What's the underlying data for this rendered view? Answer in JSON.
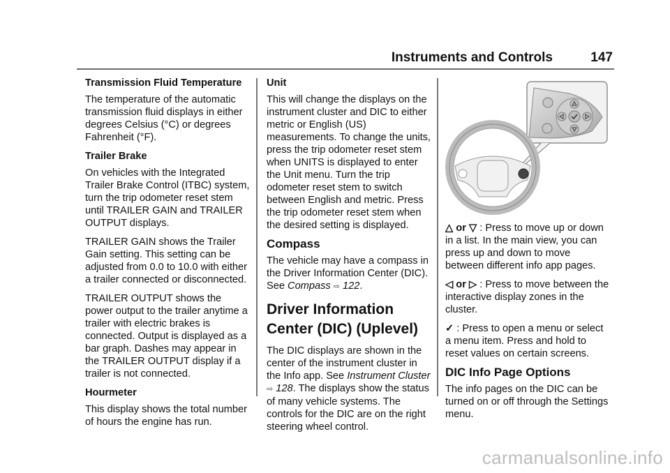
{
  "header": {
    "section": "Instruments and Controls",
    "page_number": "147"
  },
  "col1": {
    "h_transmission": "Transmission Fluid Temperature",
    "p_transmission": "The temperature of the automatic transmission fluid displays in either degrees Celsius (°C) or degrees Fahrenheit (°F).",
    "h_trailer_brake": "Trailer Brake",
    "p_trailer_brake": "On vehicles with the Integrated Trailer Brake Control (ITBC) system, turn the trip odometer reset stem until TRAILER GAIN and TRAILER OUTPUT displays.",
    "p_trailer_gain": "TRAILER GAIN shows the Trailer Gain setting. This setting can be adjusted from 0.0 to 10.0 with either a trailer connected or disconnected.",
    "p_trailer_output": "TRAILER OUTPUT shows the power output to the trailer anytime a trailer with electric brakes is connected. Output is displayed as a bar graph. Dashes may appear in the TRAILER OUTPUT display if a trailer is not connected.",
    "h_hourmeter": "Hourmeter",
    "p_hourmeter": "This display shows the total number of hours the engine has run."
  },
  "col2": {
    "h_unit": "Unit",
    "p_unit": "This will change the displays on the instrument cluster and DIC to either metric or English (US) measurements. To change the units, press the trip odometer reset stem when UNITS is displayed to enter the Unit menu. Turn the trip odometer reset stem to switch between English and metric. Press the trip odometer reset stem when the desired setting is displayed.",
    "h_compass": "Compass",
    "p_compass_pre": "The vehicle may have a compass in the Driver Information Center (DIC). See ",
    "compass_link": "Compass",
    "compass_arrow": "⇨",
    "compass_page": "122",
    "compass_post": ".",
    "h_dic": "Driver Information Center (DIC) (Uplevel)",
    "p_dic_pre": "The DIC displays are shown in the center of the instrument cluster in the Info app. See ",
    "dic_link": "Instrument Cluster",
    "dic_arrow": "⇨",
    "dic_page": "128",
    "p_dic_post": ". The displays show the status of many vehicle systems. The controls for the DIC are on the right steering wheel control."
  },
  "col3": {
    "figure_icon": "steering-wheel-controls-illustration",
    "up_symbol": "△",
    "down_symbol": "▽",
    "or_label": "or",
    "p_updown": ": Press to move up or down in a list. In the main view, you can press up and down to move between different info app pages.",
    "left_symbol": "◁",
    "right_symbol": "▷",
    "p_leftright": ": Press to move between the interactive display zones in the cluster.",
    "check_symbol": "✓",
    "p_check": ": Press to open a menu or select a menu item. Press and hold to reset values on certain screens.",
    "h_info_page": "DIC Info Page Options",
    "p_info_page": "The info pages on the DIC can be turned on or off through the Settings menu."
  },
  "watermark": "carmanualsonline.info"
}
